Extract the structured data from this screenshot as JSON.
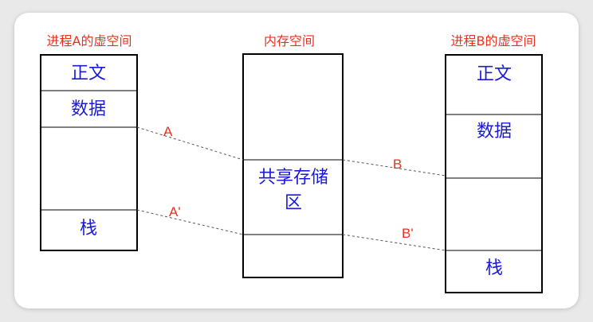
{
  "colors": {
    "background": "#e9e9e9",
    "card": "#ffffff",
    "box_border": "#000000",
    "divider": "#000000",
    "segment_text": "#1a1ad6",
    "title_text": "#e8321e",
    "connector_label": "#e8321e",
    "dash_line": "#555555"
  },
  "process_a": {
    "title": "进程A的虚空间",
    "segments": {
      "text": "正文",
      "data": "数据",
      "free": "",
      "stack": "栈"
    }
  },
  "memory": {
    "title": "内存空间",
    "shared_line1": "共享存储",
    "shared_line2": "区"
  },
  "process_b": {
    "title": "进程B的虚空间",
    "segments": {
      "text": "正文",
      "data": "数据",
      "free": "",
      "stack": "栈"
    }
  },
  "mappings": {
    "a": "A",
    "a_prime": "A'",
    "b": "B",
    "b_prime": "B'"
  }
}
